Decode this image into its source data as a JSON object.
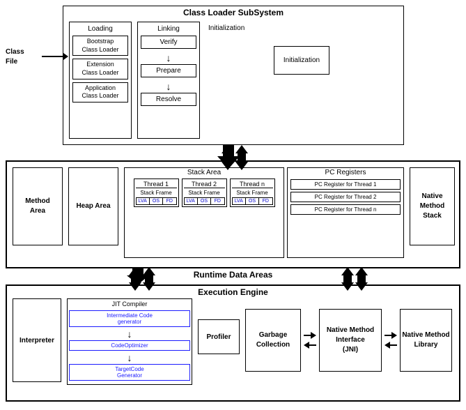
{
  "classLoaderSystem": {
    "title": "Class Loader SubSystem",
    "loading": {
      "label": "Loading",
      "loaders": [
        "Bootstrap\nClass Loader",
        "Extension\nClass Loader",
        "Application\nClass Loader"
      ]
    },
    "linking": {
      "label": "Linking",
      "steps": [
        "Verify",
        "Prepare",
        "Resolve"
      ]
    },
    "initialization": {
      "label": "Initialization",
      "box": "Initialization"
    }
  },
  "classFile": {
    "line1": "Class",
    "line2": "File"
  },
  "runtimeData": {
    "title": "Runtime Data Areas",
    "methodArea": "Method\nArea",
    "heapArea": "Heap Area",
    "stackArea": {
      "title": "Stack Area",
      "threads": [
        {
          "name": "Thread 1",
          "stackFrame": "Stack Frame",
          "cells": [
            "LVA",
            "OS",
            "FD"
          ]
        },
        {
          "name": "Thread 2",
          "stackFrame": "Stack Frame",
          "cells": [
            "LVA",
            "OS",
            "FD"
          ]
        },
        {
          "name": "Thread n",
          "stackFrame": "Stack Frame",
          "cells": [
            "LVA",
            "OS",
            "FD"
          ]
        }
      ]
    },
    "pcRegisters": {
      "title": "PC Registers",
      "items": [
        "PC Register for Thread 1",
        "PC Register for Thread 2",
        "PC Register for Thread n"
      ]
    },
    "nativeMethodStack": "Native\nMethod\nStack"
  },
  "executionEngine": {
    "title": "Execution Engine",
    "interpreter": "Interpreter",
    "jitCompiler": {
      "title": "JIT Compiler",
      "items": [
        "Intermediate Code\ngenerator",
        "Code Optimizer",
        "Target Code\nGenerator"
      ]
    },
    "profiler": "Profiler",
    "garbageCollection": "Garbage\nCollection",
    "nativeMethodInterface": "Native Method\nInterface\n(JNI)",
    "nativeMethodLibrary": "Native Method\nLibrary"
  }
}
